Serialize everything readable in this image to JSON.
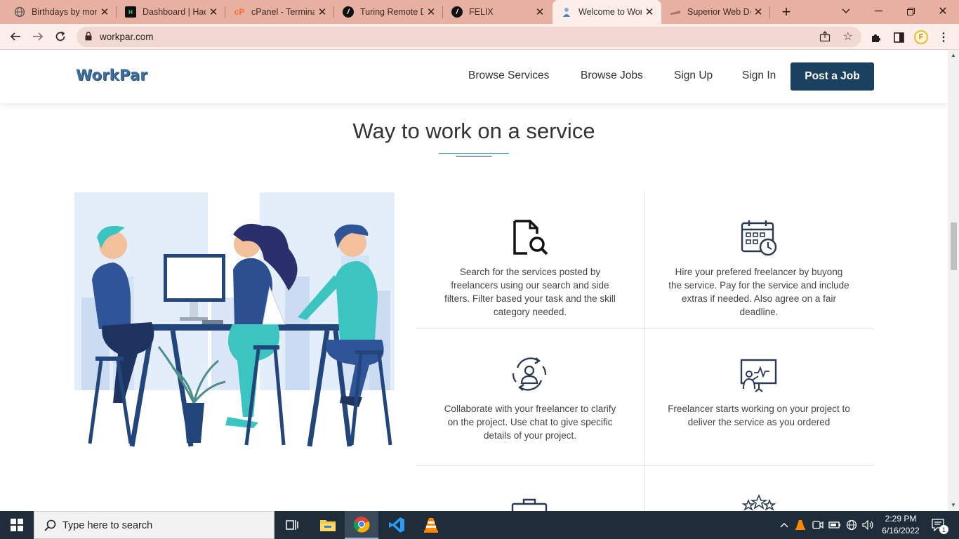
{
  "browser": {
    "tabs": [
      {
        "title": "Birthdays by mon",
        "favicon": "globe-icon"
      },
      {
        "title": "Dashboard | Hack",
        "favicon": "hackerrank-icon"
      },
      {
        "title": "cPanel - Terminal",
        "favicon": "cpanel-icon"
      },
      {
        "title": "Turing Remote D",
        "favicon": "turing-icon"
      },
      {
        "title": "FELIX",
        "favicon": "turing-icon"
      },
      {
        "title": "Welcome to Wor",
        "favicon": "workpar-icon",
        "active": true
      },
      {
        "title": "Superior Web De",
        "favicon": "superior-icon"
      }
    ],
    "url": "workpar.com",
    "profile_initial": "F"
  },
  "site": {
    "logo": "WorkPar",
    "nav": [
      "Browse Services",
      "Browse Jobs",
      "Sign Up",
      "Sign In"
    ],
    "cta": "Post a Job",
    "section_title": "Way to work on a service",
    "cards": [
      {
        "icon": "document-search-icon",
        "text": "Search for the services posted by freelancers using our search and side filters. Filter based your task and the skill category needed."
      },
      {
        "icon": "calendar-clock-icon",
        "text": "Hire your prefered freelancer by buyong the service. Pay for the service and include extras if needed. Also agree on a fair deadline."
      },
      {
        "icon": "collaborate-user-icon",
        "text": "Collaborate with your freelancer to clarify on the project. Use chat to give specific details of your project."
      },
      {
        "icon": "presentation-board-icon",
        "text": "Freelancer starts working on your project to deliver the service as you ordered"
      }
    ],
    "partial_icons": [
      "briefcase-icon",
      "stars-icon"
    ]
  },
  "taskbar": {
    "search_placeholder": "Type here to search",
    "time": "2:29 PM",
    "date": "6/16/2022",
    "notification_count": "1"
  },
  "colors": {
    "tab_strip": "#e8b0a0",
    "toolbar": "#fdeee9",
    "brand_navy": "#1a4260",
    "accent_teal": "#2fa1c5",
    "taskbar": "#1f2d3a"
  }
}
